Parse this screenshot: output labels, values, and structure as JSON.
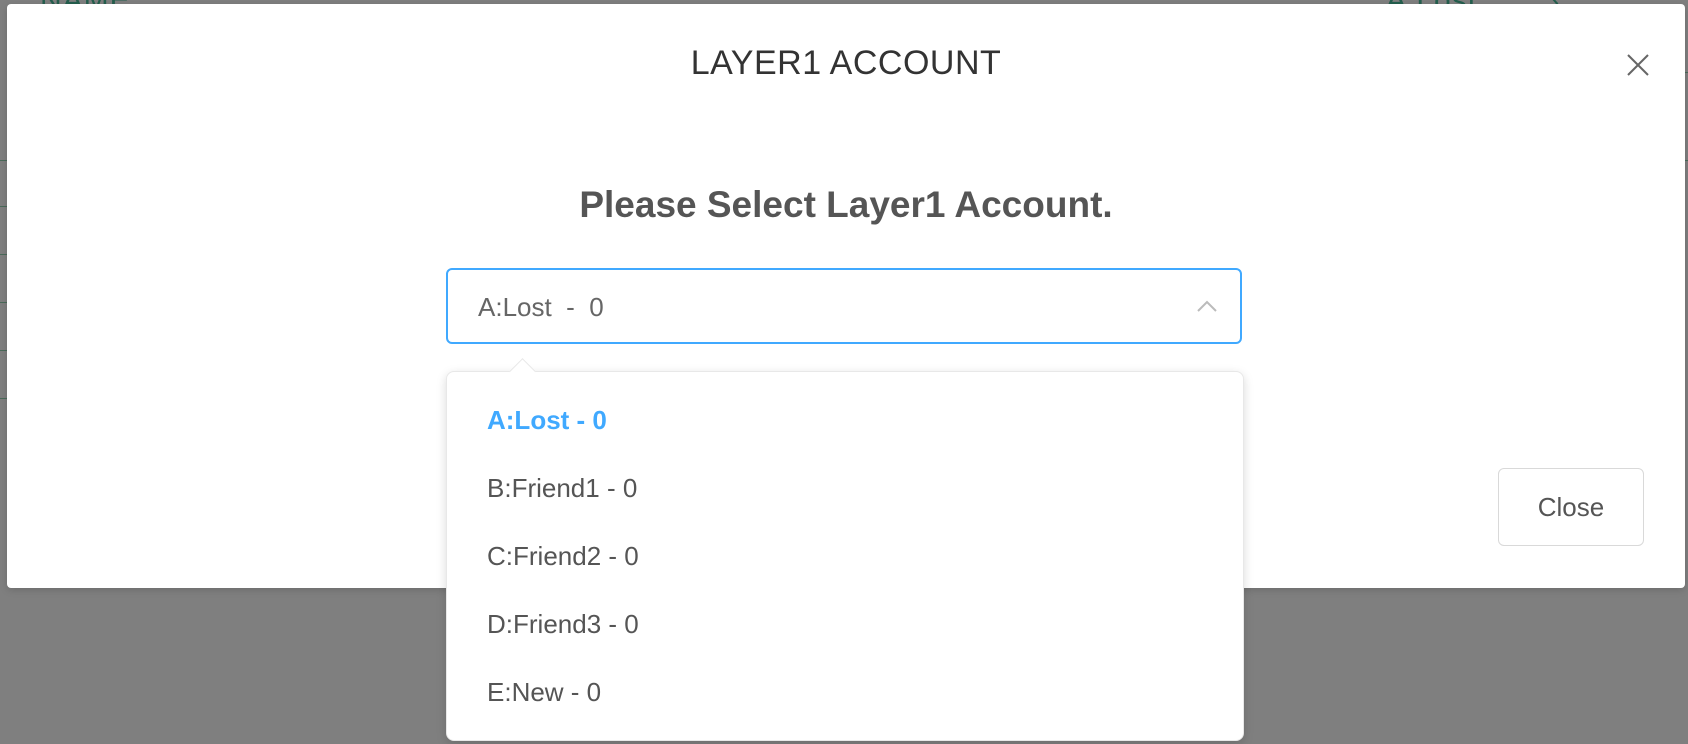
{
  "background": {
    "header_left": "NAME",
    "header_right": "A:Lost",
    "header_chevron": "›"
  },
  "modal": {
    "title": "LAYER1 ACCOUNT",
    "close_icon": "close-icon",
    "prompt": "Please Select Layer1 Account.",
    "select": {
      "value": "A:Lost  -  0",
      "arrow_icon": "chevron-up-icon",
      "border_color": "#40a9ff"
    },
    "close_button_label": "Close"
  },
  "dropdown": {
    "items": [
      {
        "label": "A:Lost - 0",
        "selected": true
      },
      {
        "label": "B:Friend1 - 0",
        "selected": false
      },
      {
        "label": "C:Friend2 - 0",
        "selected": false
      },
      {
        "label": "D:Friend3 - 0",
        "selected": false
      },
      {
        "label": "E:New - 0",
        "selected": false
      }
    ],
    "selected_color": "#40a9ff"
  },
  "colors": {
    "overlay": "#808080",
    "accent": "#40a9ff"
  }
}
